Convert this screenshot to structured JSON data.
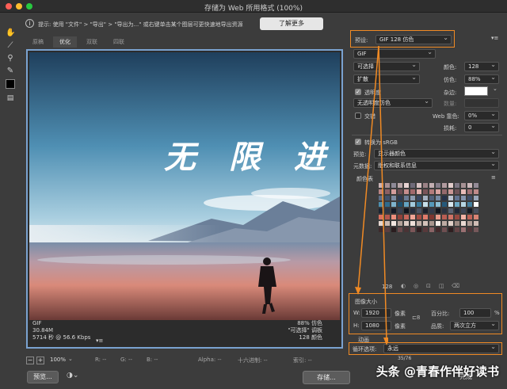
{
  "window": {
    "title": "存储为 Web 所用格式 (100%)"
  },
  "infobar": {
    "tip": "提示: 使用 \"文件\" > \"导出\" > \"导出为...\" 或右键单击某个图层可更快速地导出资源",
    "learn_more": "了解更多"
  },
  "tabs": [
    {
      "label": "原稿",
      "active": false
    },
    {
      "label": "优化",
      "active": true
    },
    {
      "label": "双联",
      "active": false
    },
    {
      "label": "四联",
      "active": false
    }
  ],
  "preview": {
    "poster_text": "无 限 进",
    "info_left": [
      "GIF",
      "30.84M",
      "5714 秒 @ 56.6 Kbps"
    ],
    "menu_icon": "▾≡",
    "info_right": [
      "88% 仿色",
      "\"可选择\" 调板",
      "128 颜色"
    ]
  },
  "bottombar": {
    "minus": "−",
    "plus": "+",
    "zoom": "100%",
    "r": "R: --",
    "g": "G: --",
    "b": "B: --",
    "alpha": "Alpha: --",
    "hex": "十六进制: --",
    "index": "索引: --"
  },
  "buttons": {
    "preview": "预览...",
    "save": "存储...",
    "done": "完成"
  },
  "settings": {
    "preset_label": "预设:",
    "preset_value": "GIF 128 仿色",
    "format": "GIF",
    "palette": "可选择",
    "colors_label": "颜色:",
    "colors_value": "128",
    "dither_algo": "扩散",
    "dither_label": "仿色:",
    "dither_value": "88%",
    "transparency_label": "透明度",
    "matte_label": "杂边:",
    "transparency_dither": "无透明度仿色",
    "amount_label": "数量:",
    "interlaced_label": "交错",
    "web_snap_label": "Web 靠色:",
    "web_snap_value": "0%",
    "lossy_label": "损耗:",
    "lossy_value": "0",
    "srgb_label": "转换为 sRGB",
    "preview_label": "预览:",
    "preview_value": "显示器颜色",
    "metadata_label": "元数据:",
    "metadata_value": "版权和联系信息",
    "color_table_label": "颜色表",
    "color_count": "128"
  },
  "image_size": {
    "title": "图像大小",
    "w_label": "W:",
    "w_value": "1920",
    "h_label": "H:",
    "h_value": "1080",
    "unit": "像素",
    "percent_label": "百分比:",
    "percent_value": "100",
    "percent_unit": "%",
    "quality_label": "品质:",
    "quality_value": "两次立方"
  },
  "animation": {
    "title": "动画",
    "loop_label": "循环选项:",
    "loop_value": "永远",
    "frame": "35/76"
  },
  "palette_colors": [
    "#c9b3b5",
    "#a78f93",
    "#8e8a97",
    "#b9a6a8",
    "#e7d3d2",
    "#6f6a78",
    "#d7c1c2",
    "#9b8286",
    "#c2aeb1",
    "#857c89",
    "#b09a9e",
    "#e1cbca",
    "#7d7683",
    "#a69194",
    "#cdb8ba",
    "#938a96",
    "#b88485",
    "#8c5f63",
    "#d49d9c",
    "#6b4c52",
    "#c58d8d",
    "#a1696c",
    "#e3b0ad",
    "#7a5459",
    "#b27b7c",
    "#d8a3a1",
    "#94696d",
    "#c99695",
    "#6e5257",
    "#e8bcb8",
    "#a27275",
    "#bf8a8a",
    "#5b6c86",
    "#41506a",
    "#7c8ba2",
    "#2e3a52",
    "#6a7a94",
    "#8d9bb0",
    "#394660",
    "#a5b0c1",
    "#51617b",
    "#768aa5",
    "#263149",
    "#b9c2d0",
    "#607190",
    "#8494ad",
    "#3f4d67",
    "#9aa6ba",
    "#4d8fae",
    "#2f6b8c",
    "#7eb3cb",
    "#1e4f6b",
    "#64a3c1",
    "#a3cbdc",
    "#387b9c",
    "#c6dfe9",
    "#5598b8",
    "#8cbfd4",
    "#25597a",
    "#d7e8ef",
    "#6daac5",
    "#b6d6e3",
    "#447f9e",
    "#ffffff",
    "#1c2433",
    "#2c3444",
    "#151b27",
    "#3a4252",
    "#0f141d",
    "#262e3d",
    "#4a5262",
    "#1a202c",
    "#333b4b",
    "#12171f",
    "#2a3240",
    "#5a6272",
    "#202837",
    "#3e4656",
    "#161c26",
    "#484f5e",
    "#d96f5f",
    "#b4564c",
    "#ec8e7c",
    "#8f4139",
    "#c7665a",
    "#f1a596",
    "#a24c43",
    "#df7b6b",
    "#7d3630",
    "#e89a89",
    "#b95e53",
    "#cf7265",
    "#964840",
    "#f3b3a6",
    "#c06257",
    "#d88374",
    "#e5d6cf",
    "#cbb9b1",
    "#f2e6e0",
    "#b3a199",
    "#dccbc3",
    "#efe0d9",
    "#c1aea6",
    "#d4c2ba",
    "#a8958d",
    "#f7ede8",
    "#beaba3",
    "#e0cfc7",
    "#9c8982",
    "#ead9d2",
    "#b09c95",
    "#d0bdb5",
    "#3d2a2c",
    "#5a3e40",
    "#2a1d1f",
    "#6b4a4c",
    "#4a3335",
    "#7c5658",
    "#321f21",
    "#58393b",
    "#8a6365",
    "#43292b",
    "#6f4f51",
    "#2f1e20",
    "#634446",
    "#9a7072",
    "#503638",
    "#76585a"
  ]
}
